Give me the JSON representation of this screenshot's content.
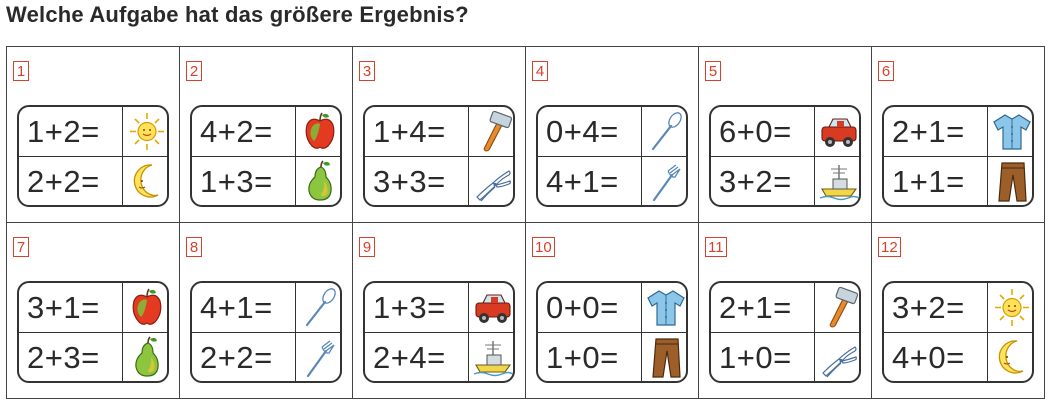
{
  "title": "Welche Aufgabe hat das größere Ergebnis?",
  "tasks": [
    {
      "number": "1",
      "top": {
        "equation": "1+2=",
        "icon": "sun-icon"
      },
      "bottom": {
        "equation": "2+2=",
        "icon": "moon-icon"
      }
    },
    {
      "number": "2",
      "top": {
        "equation": "4+2=",
        "icon": "apple-icon"
      },
      "bottom": {
        "equation": "1+3=",
        "icon": "pear-icon"
      }
    },
    {
      "number": "3",
      "top": {
        "equation": "1+4=",
        "icon": "hammer-icon"
      },
      "bottom": {
        "equation": "3+3=",
        "icon": "pliers-icon"
      }
    },
    {
      "number": "4",
      "top": {
        "equation": "0+4=",
        "icon": "spoon-icon"
      },
      "bottom": {
        "equation": "4+1=",
        "icon": "fork-icon"
      }
    },
    {
      "number": "5",
      "top": {
        "equation": "6+0=",
        "icon": "car-icon"
      },
      "bottom": {
        "equation": "3+2=",
        "icon": "boat-icon"
      }
    },
    {
      "number": "6",
      "top": {
        "equation": "2+1=",
        "icon": "shirt-icon"
      },
      "bottom": {
        "equation": "1+1=",
        "icon": "trousers-icon"
      }
    },
    {
      "number": "7",
      "top": {
        "equation": "3+1=",
        "icon": "apple-icon"
      },
      "bottom": {
        "equation": "2+3=",
        "icon": "pear-icon"
      }
    },
    {
      "number": "8",
      "top": {
        "equation": "4+1=",
        "icon": "spoon-icon"
      },
      "bottom": {
        "equation": "2+2=",
        "icon": "fork-icon"
      }
    },
    {
      "number": "9",
      "top": {
        "equation": "1+3=",
        "icon": "car-icon"
      },
      "bottom": {
        "equation": "2+4=",
        "icon": "boat-icon"
      }
    },
    {
      "number": "10",
      "top": {
        "equation": "0+0=",
        "icon": "shirt-icon"
      },
      "bottom": {
        "equation": "1+0=",
        "icon": "trousers-icon"
      }
    },
    {
      "number": "11",
      "top": {
        "equation": "2+1=",
        "icon": "hammer-icon"
      },
      "bottom": {
        "equation": "1+0=",
        "icon": "pliers-icon"
      }
    },
    {
      "number": "12",
      "top": {
        "equation": "3+2=",
        "icon": "sun-icon"
      },
      "bottom": {
        "equation": "4+0=",
        "icon": "moon-icon"
      }
    }
  ],
  "colors": {
    "number_red": "#d9402b",
    "line": "#333333"
  }
}
